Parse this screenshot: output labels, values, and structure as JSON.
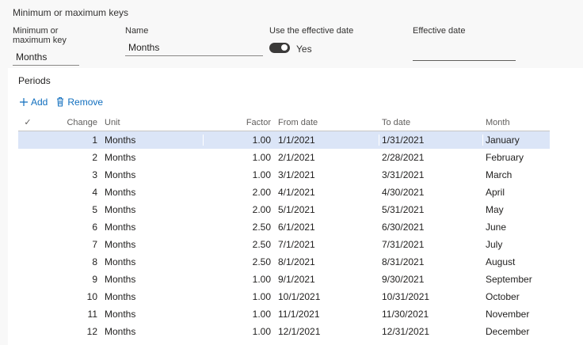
{
  "section": {
    "title": "Minimum or maximum keys"
  },
  "fields": {
    "key_label": "Minimum or maximum key",
    "key_value": "Months",
    "name_label": "Name",
    "name_value": "Months",
    "effective_label": "Use the effective date",
    "effective_toggle": "Yes",
    "effective_date_label": "Effective date",
    "effective_date_value": ""
  },
  "periods": {
    "title": "Periods",
    "add_label": "Add",
    "remove_label": "Remove",
    "columns": [
      "Change",
      "Unit",
      "Factor",
      "From date",
      "To date",
      "Month"
    ],
    "rows": [
      {
        "change": "1",
        "unit": "Months",
        "factor": "1.00",
        "from": "1/1/2021",
        "to": "1/31/2021",
        "month": "January"
      },
      {
        "change": "2",
        "unit": "Months",
        "factor": "1.00",
        "from": "2/1/2021",
        "to": "2/28/2021",
        "month": "February"
      },
      {
        "change": "3",
        "unit": "Months",
        "factor": "1.00",
        "from": "3/1/2021",
        "to": "3/31/2021",
        "month": "March"
      },
      {
        "change": "4",
        "unit": "Months",
        "factor": "2.00",
        "from": "4/1/2021",
        "to": "4/30/2021",
        "month": "April"
      },
      {
        "change": "5",
        "unit": "Months",
        "factor": "2.00",
        "from": "5/1/2021",
        "to": "5/31/2021",
        "month": "May"
      },
      {
        "change": "6",
        "unit": "Months",
        "factor": "2.50",
        "from": "6/1/2021",
        "to": "6/30/2021",
        "month": "June"
      },
      {
        "change": "7",
        "unit": "Months",
        "factor": "2.50",
        "from": "7/1/2021",
        "to": "7/31/2021",
        "month": "July"
      },
      {
        "change": "8",
        "unit": "Months",
        "factor": "2.50",
        "from": "8/1/2021",
        "to": "8/31/2021",
        "month": "August"
      },
      {
        "change": "9",
        "unit": "Months",
        "factor": "1.00",
        "from": "9/1/2021",
        "to": "9/30/2021",
        "month": "September"
      },
      {
        "change": "10",
        "unit": "Months",
        "factor": "1.00",
        "from": "10/1/2021",
        "to": "10/31/2021",
        "month": "October"
      },
      {
        "change": "11",
        "unit": "Months",
        "factor": "1.00",
        "from": "11/1/2021",
        "to": "11/30/2021",
        "month": "November"
      },
      {
        "change": "12",
        "unit": "Months",
        "factor": "1.00",
        "from": "12/1/2021",
        "to": "12/31/2021",
        "month": "December"
      }
    ],
    "selected_row": 0
  },
  "colors": {
    "accent": "#106ebe",
    "selected_row": "#dbe5f7",
    "toggle_on": "#3b3a39"
  },
  "icons": {
    "add": "plus-icon",
    "remove": "trash-icon",
    "select_all": "checkmark-icon"
  }
}
